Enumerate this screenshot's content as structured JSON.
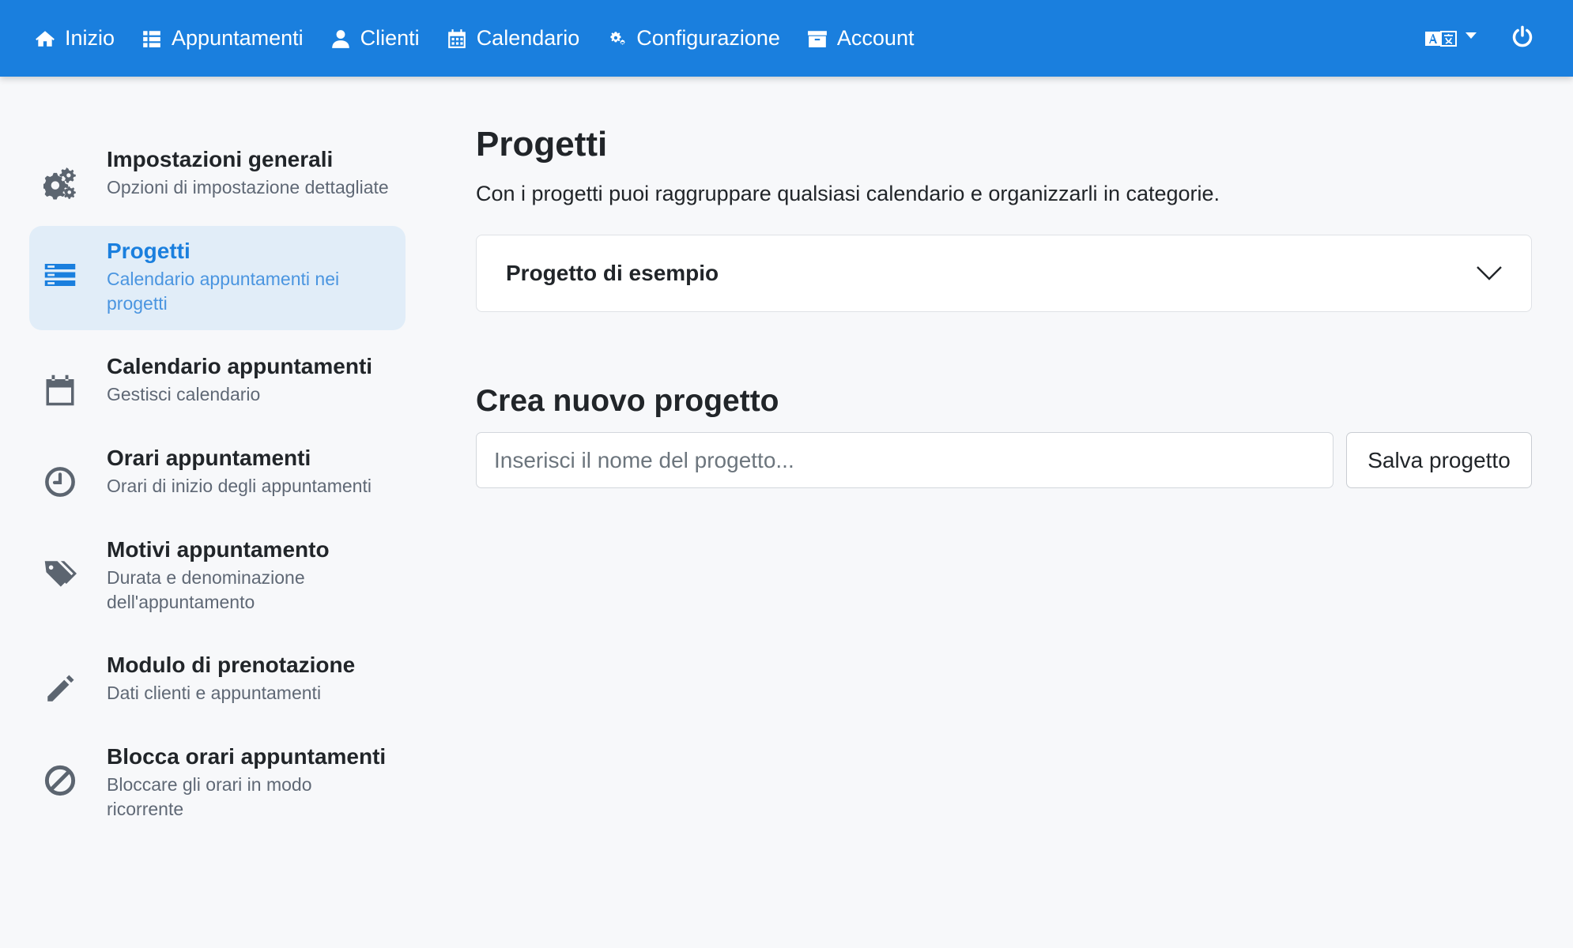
{
  "nav": {
    "items": [
      {
        "label": "Inizio",
        "icon": "home-icon"
      },
      {
        "label": "Appuntamenti",
        "icon": "list-icon"
      },
      {
        "label": "Clienti",
        "icon": "user-icon"
      },
      {
        "label": "Calendario",
        "icon": "calendar-icon"
      },
      {
        "label": "Configurazione",
        "icon": "cogs-icon"
      },
      {
        "label": "Account",
        "icon": "archive-icon"
      }
    ],
    "language_icon": "language-icon",
    "power_icon": "power-icon"
  },
  "sidebar": {
    "items": [
      {
        "title": "Impostazioni generali",
        "subtitle": "Opzioni di impostazione dettagliate",
        "icon": "cogs-icon",
        "active": false
      },
      {
        "title": "Progetti",
        "subtitle": "Calendario appuntamenti nei progetti",
        "icon": "server-icon",
        "active": true
      },
      {
        "title": "Calendario appuntamenti",
        "subtitle": "Gestisci calendario",
        "icon": "calendar-icon",
        "active": false
      },
      {
        "title": "Orari appuntamenti",
        "subtitle": "Orari di inizio degli appuntamenti",
        "icon": "clock-icon",
        "active": false
      },
      {
        "title": "Motivi appuntamento",
        "subtitle": "Durata e denominazione dell'appuntamento",
        "icon": "tags-icon",
        "active": false
      },
      {
        "title": "Modulo di prenotazione",
        "subtitle": "Dati clienti e appuntamenti",
        "icon": "pencil-icon",
        "active": false
      },
      {
        "title": "Blocca orari appuntamenti",
        "subtitle": "Bloccare gli orari in modo ricorrente",
        "icon": "ban-icon",
        "active": false
      }
    ]
  },
  "main": {
    "title": "Progetti",
    "description": "Con i progetti puoi raggruppare qualsiasi calendario e organizzarli in categorie.",
    "project": {
      "name": "Progetto di esempio",
      "expanded": false
    },
    "create": {
      "title": "Crea nuovo progetto",
      "placeholder": "Inserisci il nome del progetto...",
      "value": "",
      "save_label": "Salva progetto"
    }
  },
  "colors": {
    "primary": "#1a7fde",
    "active_bg": "#e1edf8",
    "page_bg": "#f7f8fa",
    "icon_gray": "#5c6570"
  }
}
